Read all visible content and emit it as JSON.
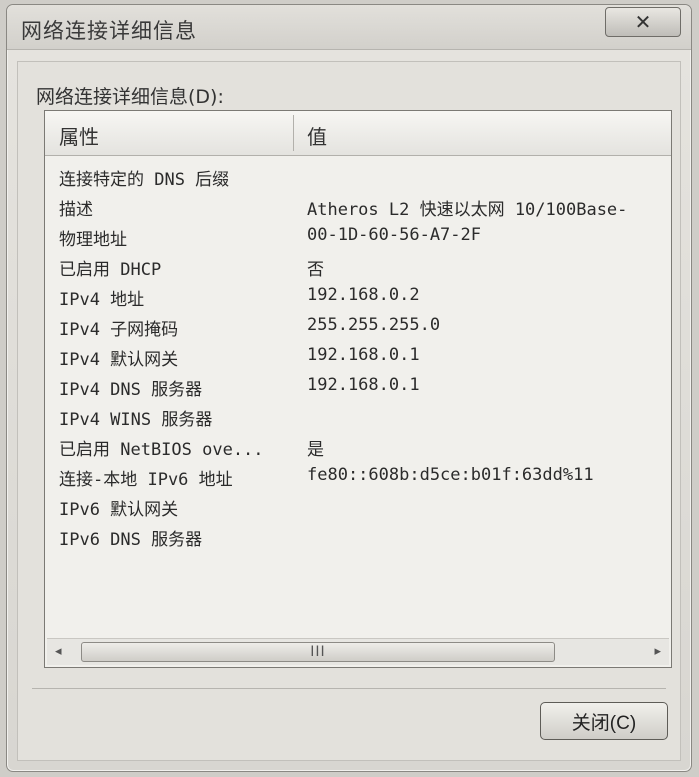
{
  "window": {
    "title": "网络连接详细信息",
    "close_glyph": "✕"
  },
  "group_label": "网络连接详细信息(D):",
  "table": {
    "columns": [
      "属性",
      "值"
    ],
    "rows": [
      {
        "property": "连接特定的 DNS 后缀",
        "value": ""
      },
      {
        "property": "描述",
        "value": "Atheros L2 快速以太网 10/100Base-"
      },
      {
        "property": "物理地址",
        "value": "00-1D-60-56-A7-2F"
      },
      {
        "property": "已启用 DHCP",
        "value": "否"
      },
      {
        "property": "IPv4 地址",
        "value": "192.168.0.2"
      },
      {
        "property": "IPv4 子网掩码",
        "value": "255.255.255.0"
      },
      {
        "property": "IPv4 默认网关",
        "value": "192.168.0.1"
      },
      {
        "property": "IPv4 DNS 服务器",
        "value": "192.168.0.1"
      },
      {
        "property": "IPv4 WINS 服务器",
        "value": ""
      },
      {
        "property": "已启用 NetBIOS ove...",
        "value": "是"
      },
      {
        "property": "连接-本地 IPv6 地址",
        "value": "fe80::608b:d5ce:b01f:63dd%11"
      },
      {
        "property": "IPv6 默认网关",
        "value": ""
      },
      {
        "property": "IPv6 DNS 服务器",
        "value": ""
      }
    ]
  },
  "scrollbar": {
    "left_arrow": "◂",
    "right_arrow": "▸",
    "thumb_grip": "III"
  },
  "buttons": {
    "close_label": "关闭(C)"
  }
}
